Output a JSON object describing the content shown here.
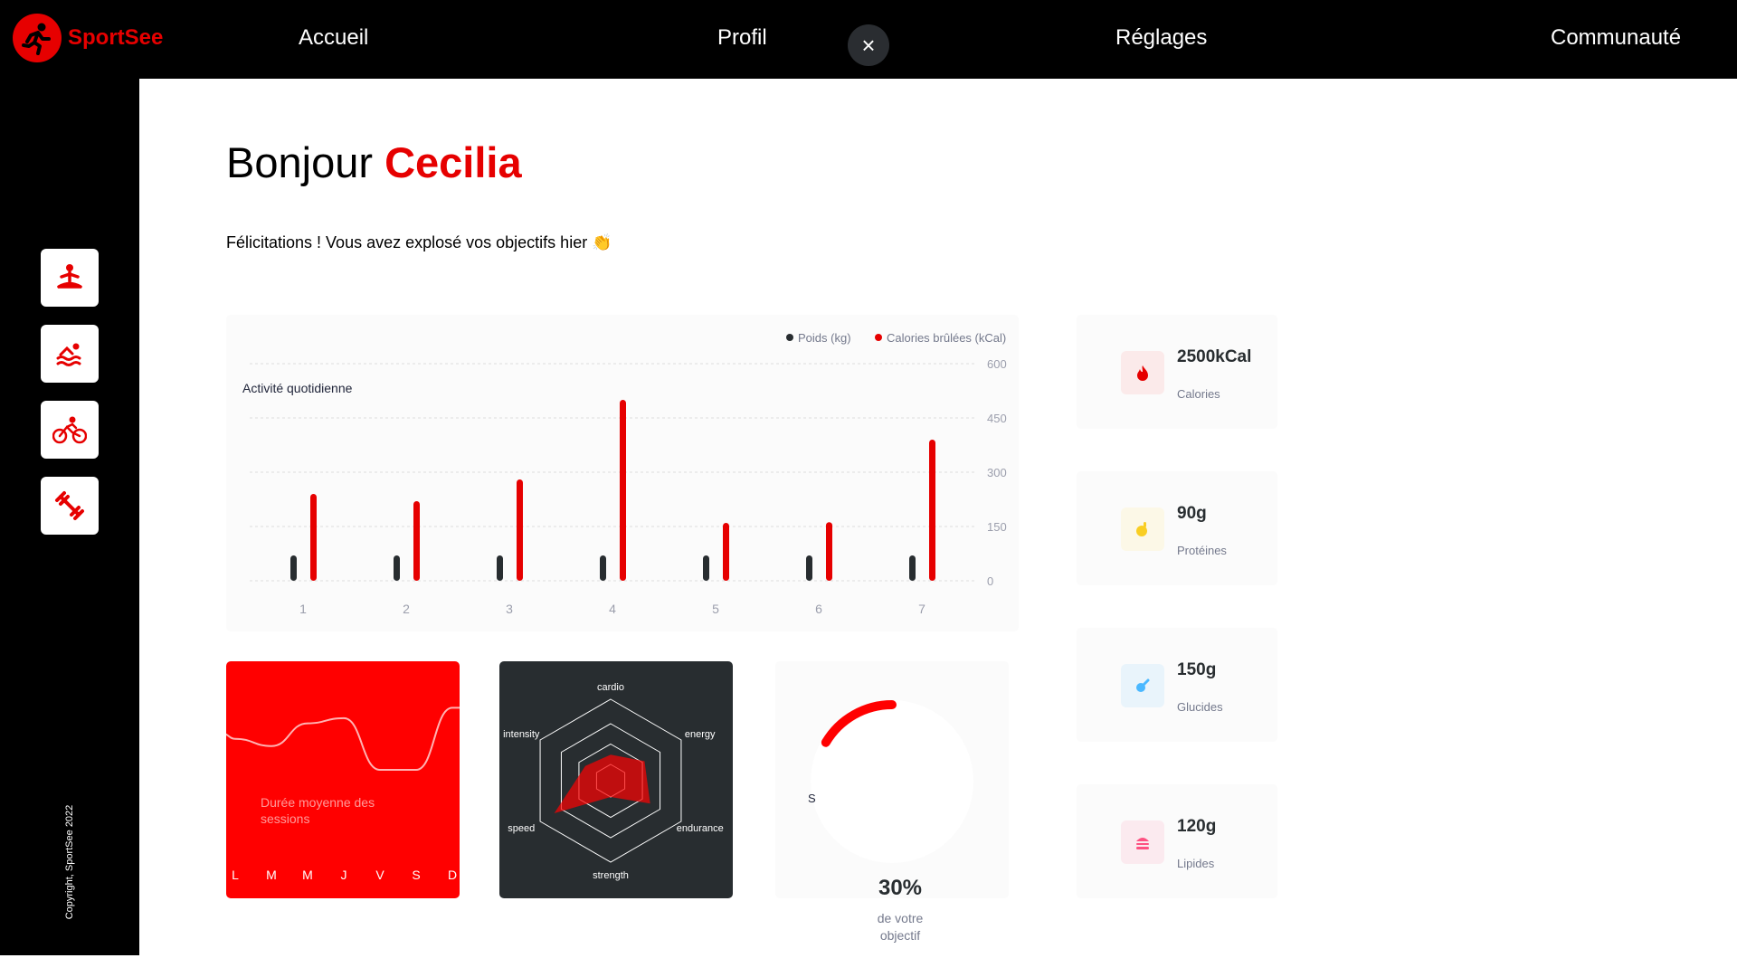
{
  "brand": {
    "name": "SportSee",
    "color": "#E60000"
  },
  "nav": {
    "home": "Accueil",
    "profile": "Profil",
    "settings": "Réglages",
    "community": "Communauté",
    "close_icon": "close-icon"
  },
  "sidebar": {
    "icons": [
      "yoga-icon",
      "swim-icon",
      "bike-icon",
      "dumbbell-icon"
    ],
    "copyright": "Copyright, SportSee 2022"
  },
  "header": {
    "greeting": "Bonjour",
    "name": "Cecilia",
    "message": "Félicitations ! Vous avez explosé vos objectifs hier 👏"
  },
  "activity": {
    "title": "Activité quotidienne",
    "legend_weight": "Poids (kg)",
    "legend_calories": "Calories brûlées (kCal)"
  },
  "sessions": {
    "title_line1": "Durée moyenne des",
    "title_line2": "sessions"
  },
  "score": {
    "value": "30%",
    "line1": "de votre",
    "line2": "objectif",
    "fragment": "S"
  },
  "key_data": [
    {
      "value": "2500kCal",
      "label": "Calories",
      "icon": "flame-icon",
      "bg": "#FBEAEA",
      "color": "#E60000"
    },
    {
      "value": "90g",
      "label": "Protéines",
      "icon": "chicken-icon",
      "bg": "#FCF8E7",
      "color": "#F9CE23"
    },
    {
      "value": "150g",
      "label": "Glucides",
      "icon": "apple-icon",
      "bg": "#E9F4FB",
      "color": "#4AB8FF"
    },
    {
      "value": "120g",
      "label": "Lipides",
      "icon": "burger-icon",
      "bg": "#FBEAEF",
      "color": "#FD5181"
    }
  ],
  "chart_data": [
    {
      "type": "bar",
      "title": "Activité quotidienne",
      "categories": [
        "1",
        "2",
        "3",
        "4",
        "5",
        "6",
        "7"
      ],
      "series": [
        {
          "name": "Poids (kg)",
          "values": [
            70,
            70,
            70,
            70,
            70,
            70,
            70
          ],
          "color": "#282D30"
        },
        {
          "name": "Calories brûlées (kCal)",
          "values": [
            240,
            220,
            280,
            500,
            160,
            162,
            390
          ],
          "color": "#E60000"
        }
      ],
      "yticks": [
        "0",
        "150",
        "300",
        "450",
        "600"
      ],
      "ylim": [
        0,
        600
      ],
      "grid": true,
      "legend": "top-right"
    },
    {
      "type": "line",
      "title": "Durée moyenne des sessions",
      "categories": [
        "L",
        "M",
        "M",
        "J",
        "V",
        "S",
        "D"
      ],
      "values": [
        30,
        23,
        45,
        50,
        0,
        0,
        60
      ]
    },
    {
      "type": "radar",
      "categories": [
        "cardio",
        "energy",
        "endurance",
        "strength",
        "speed",
        "intensity"
      ],
      "values": [
        80,
        120,
        140,
        50,
        200,
        90
      ],
      "max": 250
    },
    {
      "type": "pie",
      "title": "Score",
      "values": [
        30
      ],
      "labels": [
        "30%"
      ]
    }
  ]
}
